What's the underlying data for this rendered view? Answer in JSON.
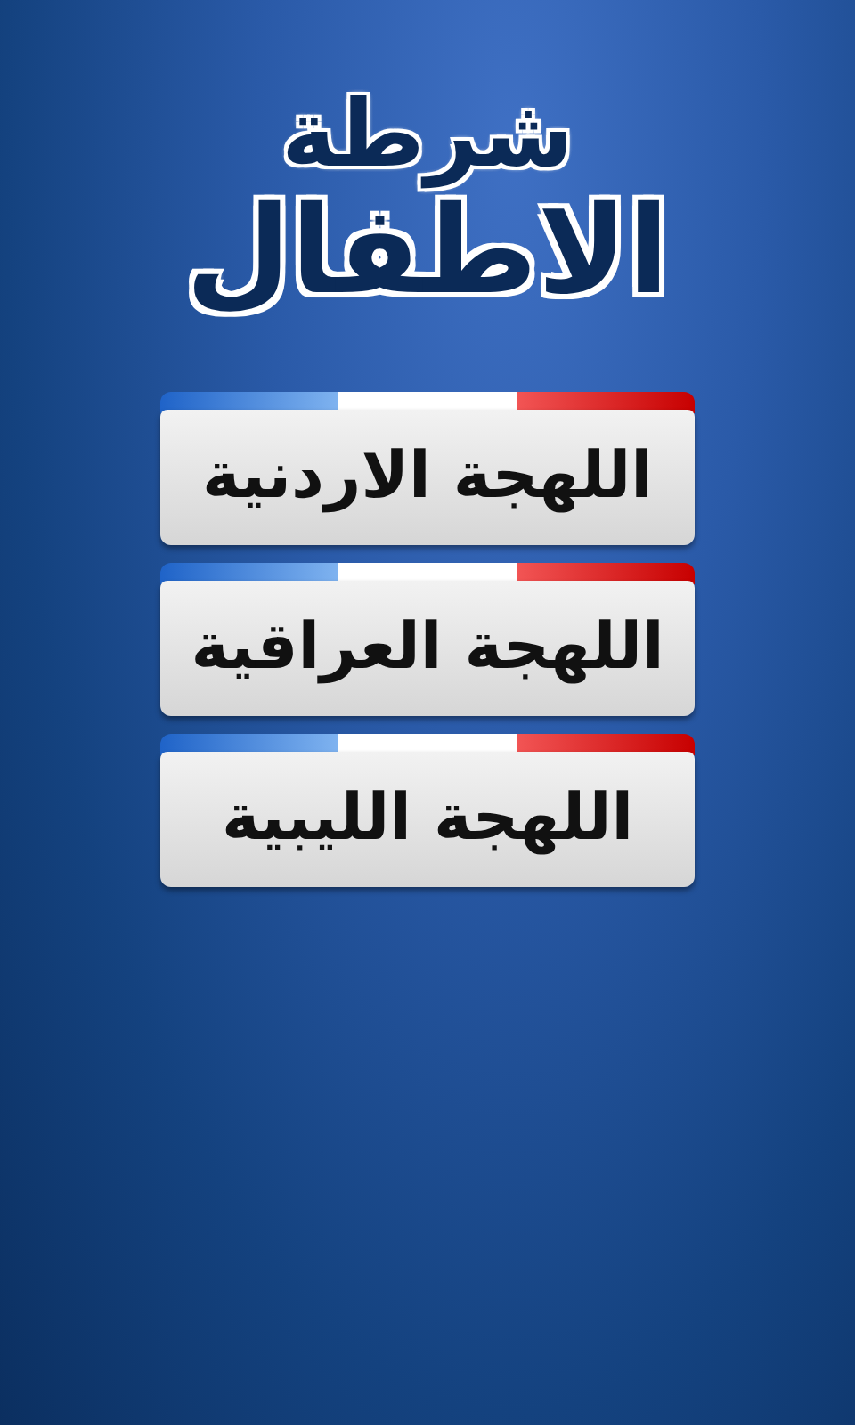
{
  "title": {
    "line_1": "شرطة",
    "line_2": "الاطفال"
  },
  "buttons": [
    {
      "label": "اللهجة الاردنية"
    },
    {
      "label": "اللهجة العراقية"
    },
    {
      "label": "اللهجة الليبية"
    }
  ]
}
